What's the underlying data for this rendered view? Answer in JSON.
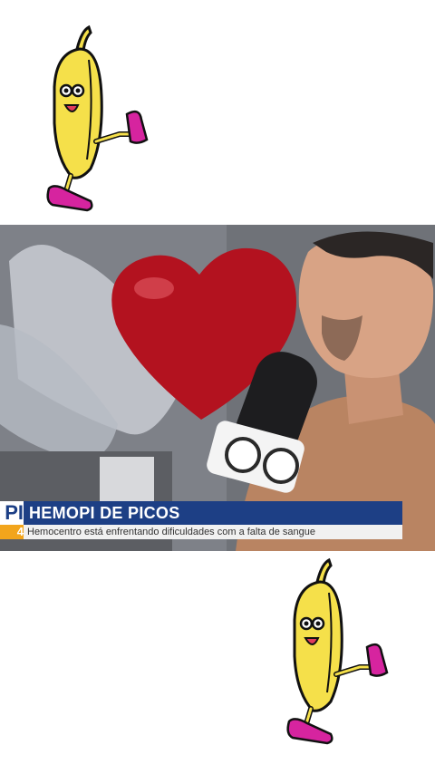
{
  "stickers": {
    "top": {
      "icon": "dancing-banana-icon"
    },
    "bottom": {
      "icon": "dancing-banana-icon"
    }
  },
  "video": {
    "broadcaster_logo": "tv-globo-logo-icon",
    "balloon": "heart-balloon-icon",
    "lower_third": {
      "tag_top": "PI",
      "tag_bottom": "4",
      "title": "HEMOPI DE PICOS",
      "subtitle": "Hemocentro está enfrentando dificuldades com a falta de sangue"
    }
  },
  "colors": {
    "banner_blue": "#1d3f85",
    "banner_orange": "#f2a51c",
    "balloon_red": "#b3121f",
    "banana_yellow": "#f5e04a",
    "shoe_magenta": "#d6249f"
  }
}
